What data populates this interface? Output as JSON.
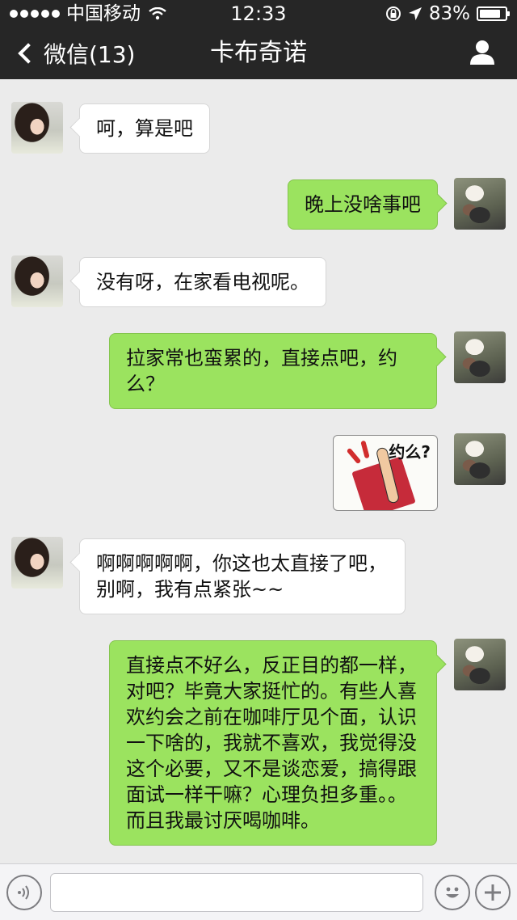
{
  "status_bar": {
    "carrier": "中国移动",
    "time": "12:33",
    "battery": "83%",
    "battery_level": 0.83
  },
  "nav": {
    "back_label": "微信(13)",
    "title": "卡布奇诺"
  },
  "messages": [
    {
      "from": "other",
      "text": "呵，算是吧"
    },
    {
      "from": "me",
      "text": "晚上没啥事吧"
    },
    {
      "from": "other",
      "text": "没有呀，在家看电视呢。"
    },
    {
      "from": "me",
      "text": "拉家常也蛮累的，直接点吧，约么？"
    },
    {
      "from": "me",
      "type": "sticker",
      "text": "约么?"
    },
    {
      "from": "other",
      "text": "啊啊啊啊啊，你这也太直接了吧，别啊，我有点紧张~~"
    },
    {
      "from": "me",
      "text": "直接点不好么，反正目的都一样，对吧？毕竟大家挺忙的。有些人喜欢约会之前在咖啡厅见个面，认识一下啥的，我就不喜欢，我觉得没这个必要，又不是谈恋爱，搞得跟面试一样干嘛？心理负担多重。。而且我最讨厌喝咖啡。"
    }
  ],
  "colors": {
    "header_bg": "#262626",
    "chat_bg": "#ebebeb",
    "out_bubble": "#9be35f",
    "in_bubble": "#ffffff"
  },
  "icons": {
    "back": "chevron-left-icon",
    "profile": "person-icon",
    "voice": "voice-icon",
    "emoji": "emoji-icon",
    "more": "plus-icon"
  },
  "input": {
    "value": ""
  }
}
